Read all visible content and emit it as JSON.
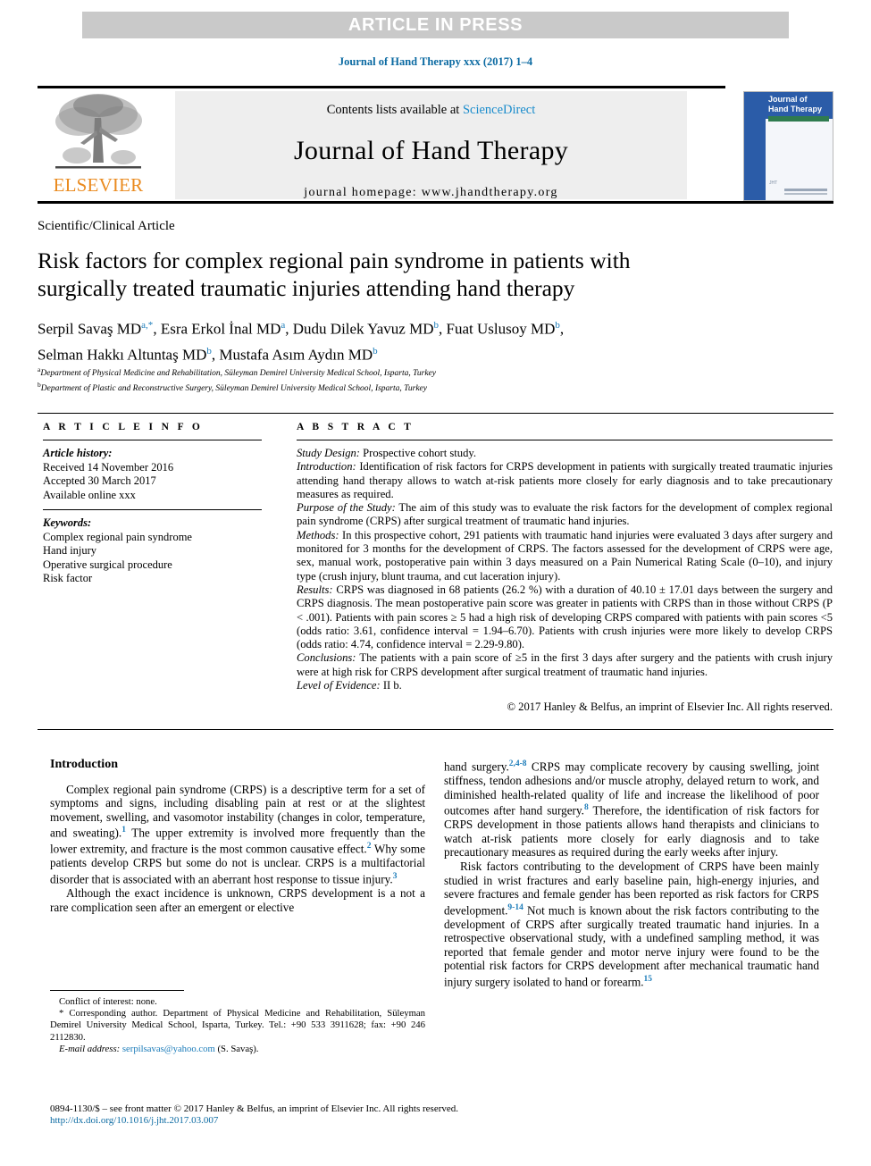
{
  "banner": {
    "text": "ARTICLE IN PRESS"
  },
  "running_head": {
    "text": "Journal of Hand Therapy xxx (2017) 1–4"
  },
  "masthead": {
    "contents_prefix": "Contents lists available at ",
    "sciencedirect": "ScienceDirect",
    "journal_title": "Journal of Hand Therapy",
    "homepage": "journal homepage: www.jhandtherapy.org",
    "publisher_name": "ELSEVIER",
    "cover": {
      "line1": "Journal of",
      "line2": "Hand Therapy",
      "footer_mark": "JHT"
    }
  },
  "article": {
    "type": "Scientific/Clinical Article",
    "title_line1": "Risk factors for complex regional pain syndrome in patients with",
    "title_line2": "surgically treated traumatic injuries attending hand therapy",
    "authors_line1_part1": "Serpil Savaş MD",
    "authors_line1_sup1": "a,*",
    "authors_line1_part2": ", Esra Erkol İnal MD",
    "authors_line1_sup2": "a",
    "authors_line1_part3": ", Dudu Dilek Yavuz MD",
    "authors_line1_sup3": "b",
    "authors_line1_part4": ", Fuat Uslusoy MD",
    "authors_line1_sup4": "b",
    "authors_line1_part5": ",",
    "authors_line2_part1": "Selman Hakkı Altuntaş MD",
    "authors_line2_sup1": "b",
    "authors_line2_part2": ", Mustafa Asım Aydın MD",
    "authors_line2_sup2": "b",
    "affiliation_a_marker": "a",
    "affiliation_a": "Department of Physical Medicine and Rehabilitation, Süleyman Demirel University Medical School, Isparta, Turkey",
    "affiliation_b_marker": "b",
    "affiliation_b": "Department of Plastic and Reconstructive Surgery, Süleyman Demirel University Medical School, Isparta, Turkey"
  },
  "article_info": {
    "heading": "A R T I C L E   I N F O",
    "history_label": "Article history:",
    "received": "Received 14 November 2016",
    "accepted": "Accepted 30 March 2017",
    "available": "Available online xxx",
    "keywords_label": "Keywords:",
    "keywords": [
      "Complex regional pain syndrome",
      "Hand injury",
      "Operative surgical procedure",
      "Risk factor"
    ]
  },
  "abstract": {
    "heading": "A B S T R A C T",
    "sections": [
      {
        "label": "Study Design:",
        "text": " Prospective cohort study."
      },
      {
        "label": "Introduction:",
        "text": " Identification of risk factors for CRPS development in patients with surgically treated traumatic injuries attending hand therapy allows to watch at-risk patients more closely for early diagnosis and to take precautionary measures as required."
      },
      {
        "label": "Purpose of the Study:",
        "text": " The aim of this study was to evaluate the risk factors for the development of complex regional pain syndrome (CRPS) after surgical treatment of traumatic hand injuries."
      },
      {
        "label": "Methods:",
        "text": " In this prospective cohort, 291 patients with traumatic hand injuries were evaluated 3 days after surgery and monitored for 3 months for the development of CRPS. The factors assessed for the development of CRPS were age, sex, manual work, postoperative pain within 3 days measured on a Pain Numerical Rating Scale (0–10), and injury type (crush injury, blunt trauma, and cut laceration injury)."
      },
      {
        "label": "Results:",
        "text": " CRPS was diagnosed in 68 patients (26.2 %) with a duration of 40.10 ± 17.01 days between the surgery and CRPS diagnosis. The mean postoperative pain score was greater in patients with CRPS than in those without CRPS (P < .001). Patients with pain scores ≥ 5 had a high risk of developing CRPS compared with patients with pain scores <5 (odds ratio: 3.61, confidence interval = 1.94–6.70). Patients with crush injuries were more likely to develop CRPS (odds ratio: 4.74, confidence interval = 2.29-9.80)."
      },
      {
        "label": "Conclusions:",
        "text": " The patients with a pain score of ≥5 in the first 3 days after surgery and the patients with crush injury were at high risk for CRPS development after surgical treatment of traumatic hand injuries."
      },
      {
        "label": "Level of Evidence:",
        "text": " II b."
      }
    ],
    "copyright": "© 2017 Hanley & Belfus, an imprint of Elsevier Inc. All rights reserved."
  },
  "body": {
    "left": {
      "heading": "Introduction",
      "para1_a": "Complex regional pain syndrome (CRPS) is a descriptive term for a set of symptoms and signs, including disabling pain at rest or at the slightest movement, swelling, and vasomotor instability (changes in color, temperature, and sweating).",
      "para1_ref1": "1",
      "para1_b": " The upper extremity is involved more frequently than the lower extremity, and fracture is the most common causative effect.",
      "para1_ref2": "2",
      "para1_c": " Why some patients develop CRPS but some do not is unclear. CRPS is a multifactorial disorder that is associated with an aberrant host response to tissue injury.",
      "para1_ref3": "3",
      "para2": "Although the exact incidence is unknown, CRPS development is a not a rare complication seen after an emergent or elective"
    },
    "right": {
      "para1_a": "hand surgery.",
      "para1_ref1": "2,4-8",
      "para1_b": " CRPS may complicate recovery by causing swelling, joint stiffness, tendon adhesions and/or muscle atrophy, delayed return to work, and diminished health-related quality of life and increase the likelihood of poor outcomes after hand surgery.",
      "para1_ref2": "8",
      "para1_c": " Therefore, the identification of risk factors for CRPS development in those patients allows hand therapists and clinicians to watch at-risk patients more closely for early diagnosis and to take precautionary measures as required during the early weeks after injury.",
      "para2_a": "Risk factors contributing to the development of CRPS have been mainly studied in wrist fractures and early baseline pain, high-energy injuries, and severe fractures and female gender has been reported as risk factors for CRPS development.",
      "para2_ref1": "9-14",
      "para2_b": " Not much is known about the risk factors contributing to the development of CRPS after surgically treated traumatic hand injuries. In a retrospective observational study, with a undefined sampling method, it was reported that female gender and motor nerve injury were found to be the potential risk factors for CRPS development after mechanical traumatic hand injury surgery isolated to hand or forearm.",
      "para2_ref2": "15"
    }
  },
  "footnotes": {
    "conflict": "Conflict of interest: none.",
    "corresponding": "* Corresponding author. Department of Physical Medicine and Rehabilitation, Süleyman Demirel University Medical School, Isparta, Turkey. Tel.: +90 533 3911628; fax: +90 246 2112830.",
    "email_label": "E-mail address:",
    "email": "serpilsavas@yahoo.com",
    "email_owner": " (S. Savaş)."
  },
  "footer": {
    "issn": "0894-1130/$ – see front matter © 2017 Hanley & Belfus, an imprint of Elsevier Inc. All rights reserved.",
    "doi": "http://dx.doi.org/10.1016/j.jht.2017.03.007"
  },
  "colors": {
    "link_blue": "#1a7bb9",
    "running_head_blue": "#0b6aa2",
    "elsevier_orange": "#ea8b20",
    "banner_gray": "#c9c9c9",
    "masthead_gray": "#eeeeee",
    "cover_blue": "#2b5ca8"
  }
}
